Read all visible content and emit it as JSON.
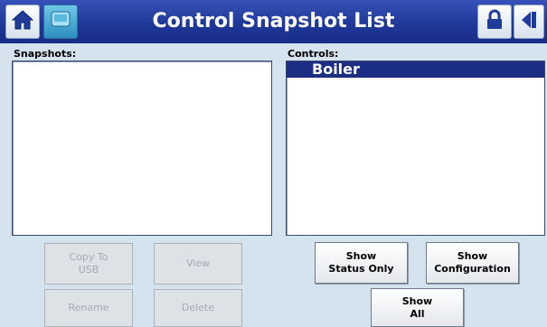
{
  "header": {
    "title": "Control Snapshot List",
    "icons": {
      "home": "home-icon",
      "app": "app-icon",
      "lock": "lock-icon",
      "back": "back-arrow-icon"
    }
  },
  "snapshots": {
    "label": "Snapshots:",
    "items": []
  },
  "controls": {
    "label": "Controls:",
    "items": [
      "Boiler"
    ],
    "selected": "Boiler"
  },
  "buttons": {
    "copy_to_usb": "Copy To\nUSB",
    "view": "View",
    "rename": "Rename",
    "delete": "Delete",
    "show_status_only": "Show\nStatus Only",
    "show_configuration": "Show\nConfiguration",
    "show_all": "Show\nAll"
  },
  "colors": {
    "title_bar": "#1f3898",
    "background": "#d5e3ef",
    "selection": "#1c2d84"
  }
}
